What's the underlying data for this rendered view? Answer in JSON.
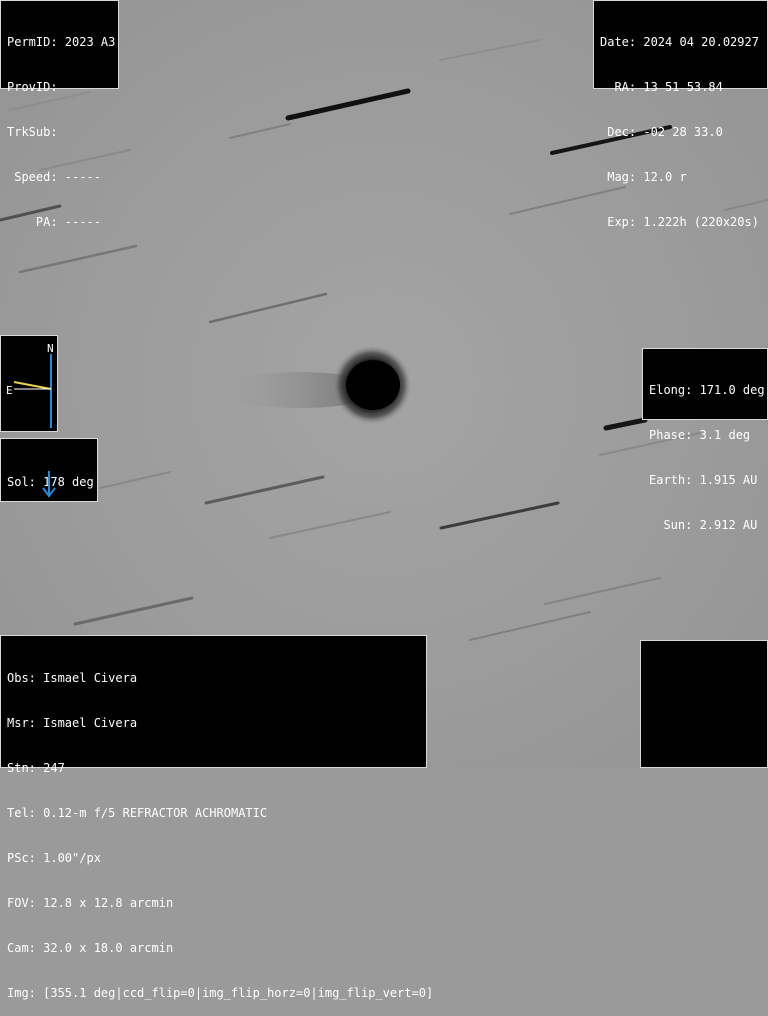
{
  "top_left": {
    "lines": [
      "PermID: 2023 A3",
      "ProvID:",
      "TrkSub:",
      " Speed: -----",
      "    PA: -----"
    ]
  },
  "top_right": {
    "lines": [
      "Date: 2024 04 20.02927",
      "  RA: 13 51 53.84",
      " Dec: -02 28 33.0",
      " Mag: 12.0 r",
      " Exp: 1.222h (220x20s)"
    ]
  },
  "compass": {
    "north_label": "N",
    "east_label": "E",
    "north_color": "#2a8ad6",
    "east_color": "#e8d44a"
  },
  "sol": {
    "text": "Sol: 178 deg",
    "arrow_icon": "arrow-down-icon",
    "arrow_color": "#2a8ad6"
  },
  "geometry": {
    "lines": [
      "Elong: 171.0 deg",
      "Phase: 3.1 deg",
      "Earth: 1.915 AU",
      "  Sun: 2.912 AU"
    ]
  },
  "observer": {
    "lines": [
      "Obs: Ismael Civera",
      "Msr: Ismael Civera",
      "Stn: 247",
      "Tel: 0.12-m f/5 REFRACTOR ACHROMATIC",
      "PSc: 1.00\"/px",
      "FOV: 12.8 x 12.8 arcmin",
      "Cam: 32.0 x 18.0 arcmin",
      "Img: [355.1 deg|ccd_flip=0|img_flip_horz=0|img_flip_vert=0]"
    ]
  }
}
